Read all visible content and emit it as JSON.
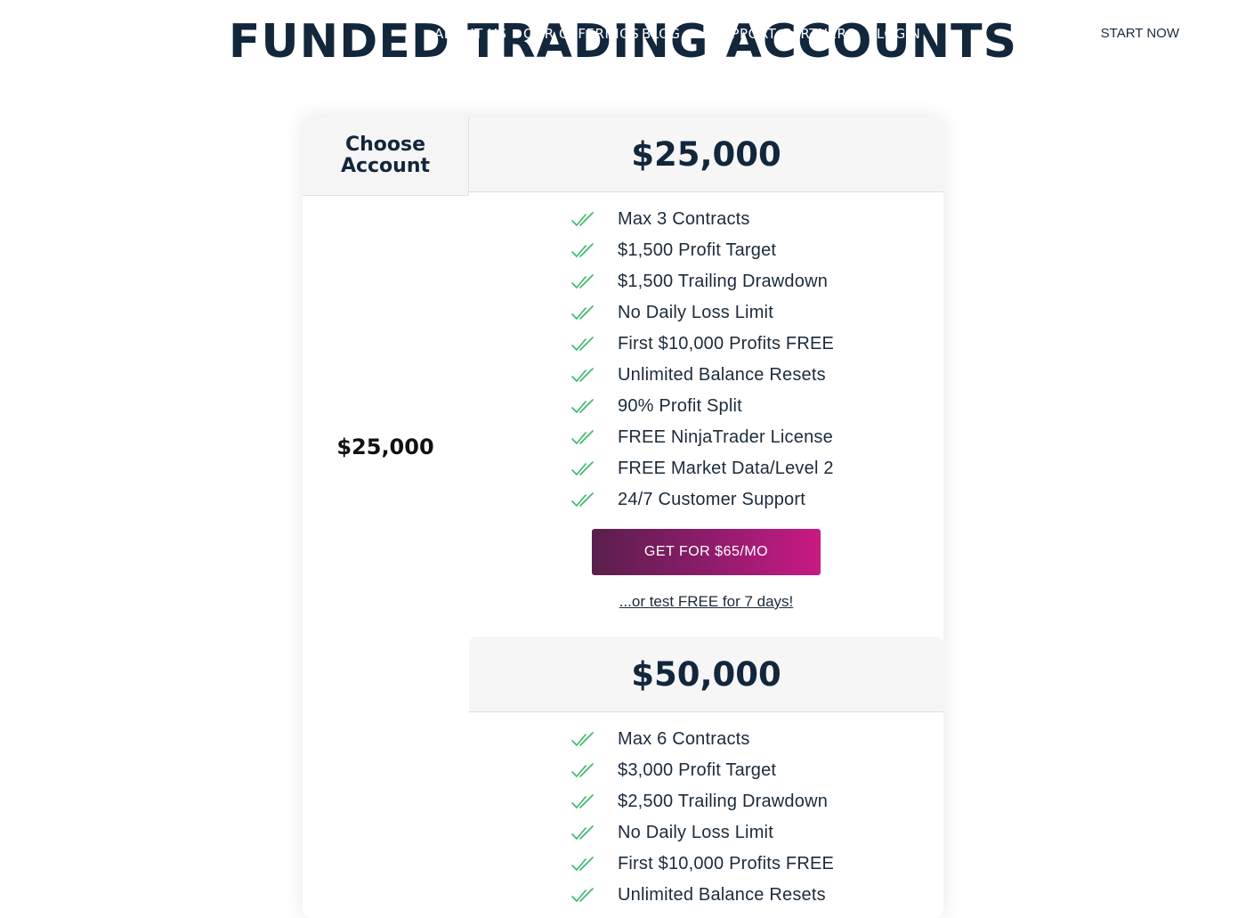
{
  "header": {
    "title": "FUNDED TRADING ACCOUNTS",
    "nav": [
      "ABOUT US",
      "OUR OFFERINGS",
      "BLOG",
      "SUPPORT",
      "PARTNERS",
      "LOGIN"
    ],
    "start_now": "START NOW"
  },
  "table": {
    "choose_label": "Choose Account",
    "selected_account": "$25,000"
  },
  "plans": [
    {
      "price": "$25,000",
      "features": [
        "Max 3 Contracts",
        "$1,500 Profit Target",
        "$1,500 Trailing Drawdown",
        "No Daily Loss Limit",
        "First $10,000 Profits FREE",
        "Unlimited Balance Resets",
        "90% Profit Split",
        "FREE NinjaTrader License",
        "FREE Market Data/Level 2",
        "24/7 Customer Support"
      ],
      "cta": "GET FOR $65/MO",
      "trial": "...or test FREE for 7 days!"
    },
    {
      "price": "$50,000",
      "features": [
        "Max 6 Contracts",
        "$3,000 Profit Target",
        "$2,500 Trailing Drawdown",
        "No Daily Loss Limit",
        "First $10,000 Profits FREE",
        "Unlimited Balance Resets"
      ]
    }
  ],
  "colors": {
    "navy": "#12263c",
    "check_green": "#3bb86a",
    "cta_gradient_start": "#5a1f4c",
    "cta_gradient_end": "#c91a84"
  },
  "icons": {
    "check": "double-check-icon"
  }
}
